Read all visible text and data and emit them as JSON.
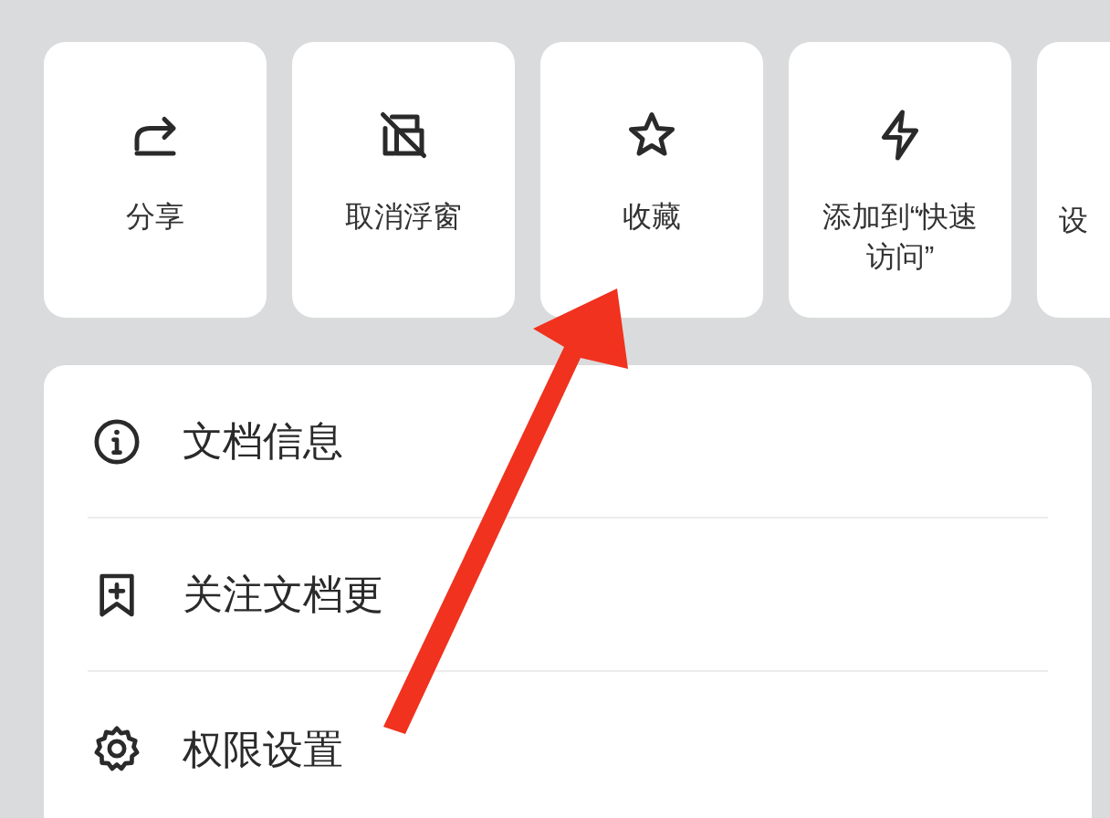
{
  "actions": [
    {
      "kind": "share",
      "label": "分享"
    },
    {
      "kind": "unfloat",
      "label": "取消浮窗"
    },
    {
      "kind": "star",
      "label": "收藏"
    },
    {
      "kind": "bolt",
      "label": "添加到“快速访问”"
    },
    {
      "kind": "partial",
      "label": "设"
    }
  ],
  "menu": [
    {
      "kind": "info",
      "label": "文档信息"
    },
    {
      "kind": "bookmark",
      "label": "关注文档更"
    },
    {
      "kind": "gear",
      "label": "权限设置"
    }
  ]
}
